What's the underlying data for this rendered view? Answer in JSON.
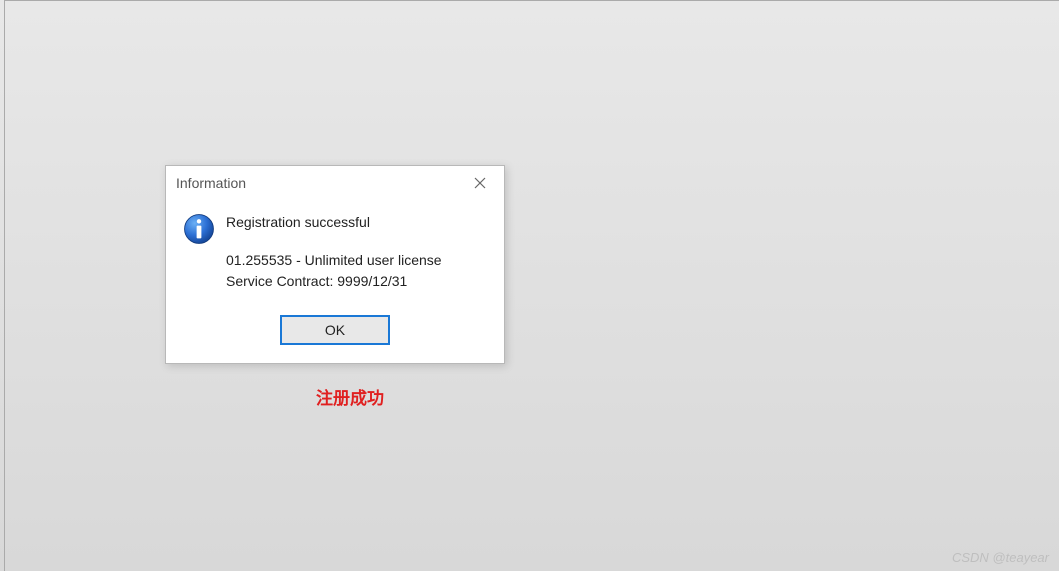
{
  "dialog": {
    "title": "Information",
    "close_icon": "close",
    "icon": "info-icon",
    "heading": "Registration successful",
    "line1": "01.255535 - Unlimited user license",
    "line2": "Service Contract: 9999/12/31",
    "ok_label": "OK"
  },
  "caption": "注册成功",
  "watermark": "CSDN @teayear"
}
